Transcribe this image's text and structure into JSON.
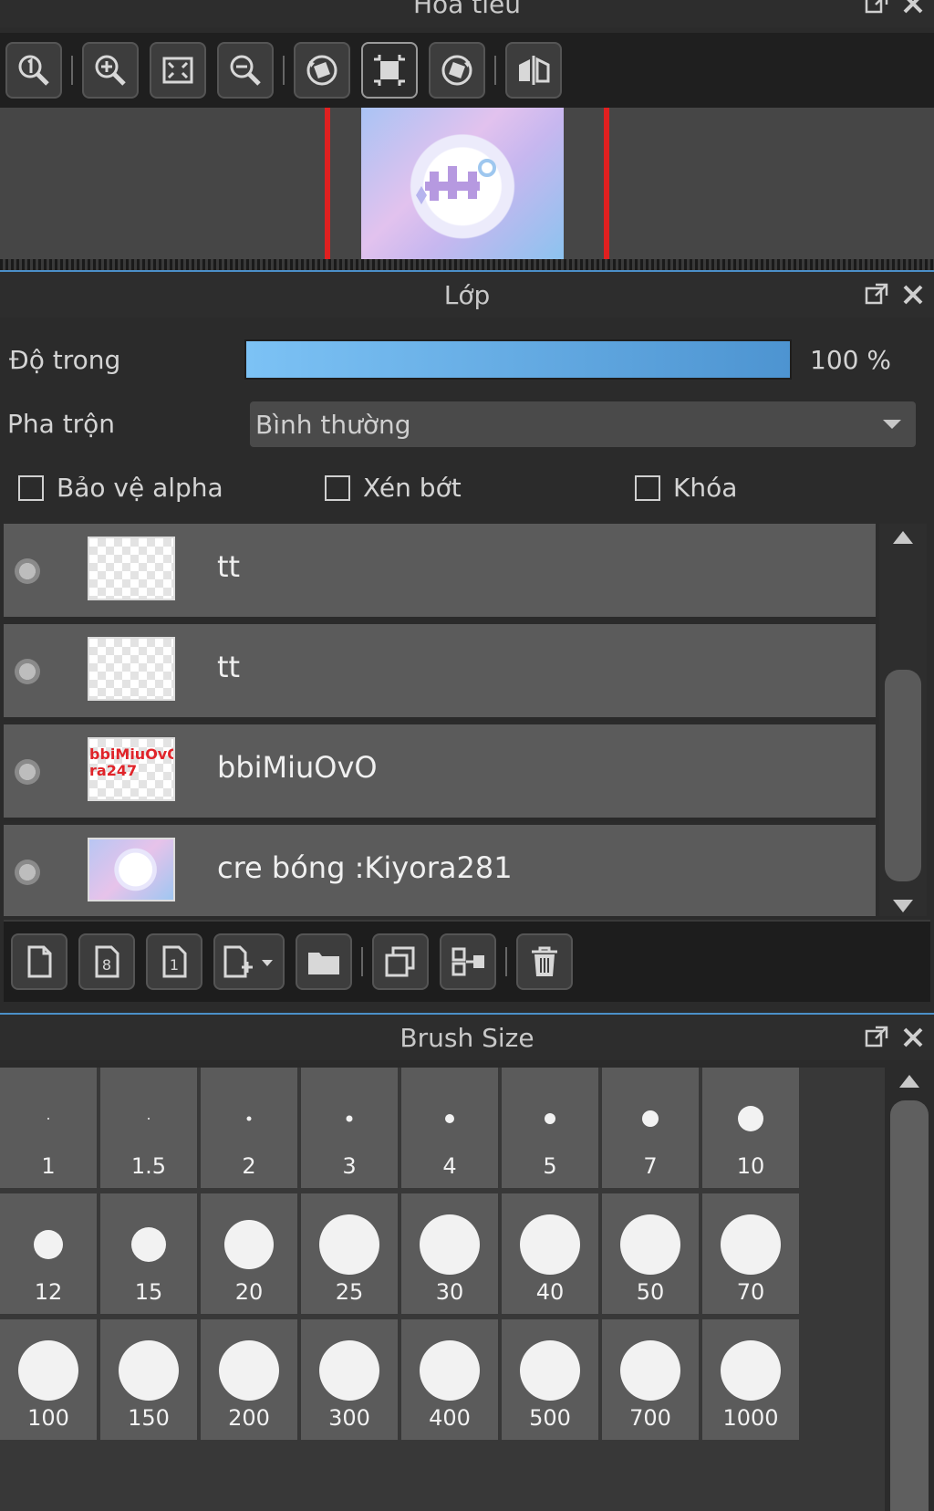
{
  "navigator": {
    "title": "Hoa tiêu",
    "toolbar": [
      {
        "icon": "zoom-actual-icon"
      },
      {
        "icon": "zoom-in-icon"
      },
      {
        "icon": "fit-screen-icon"
      },
      {
        "icon": "zoom-out-icon"
      },
      {
        "icon": "rotate-left-icon"
      },
      {
        "icon": "fit-frame-icon",
        "active": true
      },
      {
        "icon": "rotate-right-icon"
      },
      {
        "icon": "flip-horizontal-icon"
      }
    ]
  },
  "layers_panel": {
    "title": "Lớp",
    "opacity_label": "Độ trong",
    "opacity_value": "100 %",
    "opacity_fraction": 1.0,
    "blend_label": "Pha trộn",
    "blend_value": "Bình thường",
    "checkboxes": [
      {
        "label": "Bảo vệ alpha",
        "checked": false
      },
      {
        "label": "Xén bớt",
        "checked": false
      },
      {
        "label": "Khóa",
        "checked": false
      }
    ],
    "layers": [
      {
        "name": "tt",
        "thumb": "transparent"
      },
      {
        "name": "tt",
        "thumb": "transparent"
      },
      {
        "name": "bbiMiuOvO",
        "thumb": "text",
        "thumb_text": [
          "bbiMiuOvO",
          "ra247"
        ]
      },
      {
        "name": "cre bóng :Kiyora281",
        "thumb": "art"
      }
    ],
    "toolbar": [
      {
        "icon": "new-layer-icon"
      },
      {
        "icon": "new-8bit-layer-icon"
      },
      {
        "icon": "new-1bit-layer-icon"
      },
      {
        "icon": "add-layer-dropdown-icon"
      },
      {
        "icon": "new-folder-icon"
      },
      {
        "icon": "duplicate-layer-icon"
      },
      {
        "icon": "merge-down-icon"
      },
      {
        "icon": "delete-layer-icon"
      }
    ]
  },
  "brush_size_panel": {
    "title": "Brush Size",
    "sizes": [
      "1",
      "1.5",
      "2",
      "3",
      "4",
      "5",
      "7",
      "10",
      "12",
      "15",
      "20",
      "25",
      "30",
      "40",
      "50",
      "70",
      "100",
      "150",
      "200",
      "300",
      "400",
      "500",
      "700",
      "1000"
    ]
  },
  "colors": {
    "accent": "#4b8fc8",
    "opacity_bar_start": "#7cc2f5",
    "opacity_bar_end": "#4d94d1",
    "panel_bg": "#2b2b2b",
    "row_bg": "#5b5b5b"
  }
}
